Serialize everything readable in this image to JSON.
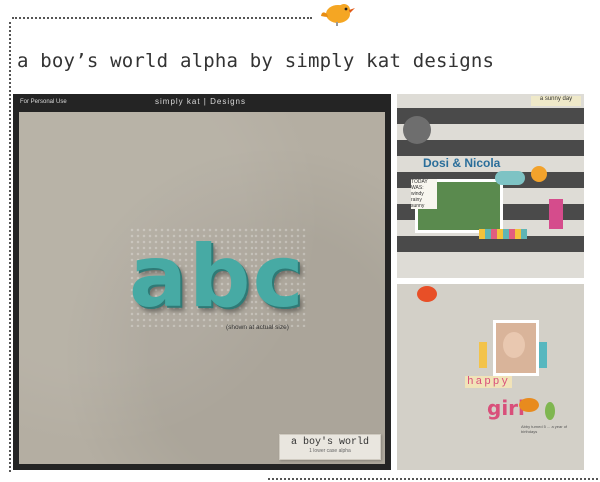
{
  "page_title": "a boy’s world alpha by simply kat designs",
  "icons": {
    "mascot": "yellow-bird-icon"
  },
  "preview": {
    "personal_use": "For Personal Use",
    "brand": "simply kat | Designs",
    "letters": [
      "a",
      "b",
      "c"
    ],
    "shown_size": "(shown at actual size)",
    "label_title": "a boy's world",
    "label_subtitle": "1 lower case alpha",
    "colors": {
      "background": "#242424",
      "paper": "#b4aea2",
      "letters": "#47aaa4"
    }
  },
  "layout1": {
    "tag": "a sunny day",
    "title": "Dosi & Nicola",
    "note_title": "TODAY WAS:",
    "note_items": [
      "windy",
      "rainy",
      "sunny"
    ]
  },
  "layout2": {
    "word1": "happy",
    "word2": "girl",
    "number": "5",
    "journal": "Abby turned 5 ... a year of birthdays"
  }
}
